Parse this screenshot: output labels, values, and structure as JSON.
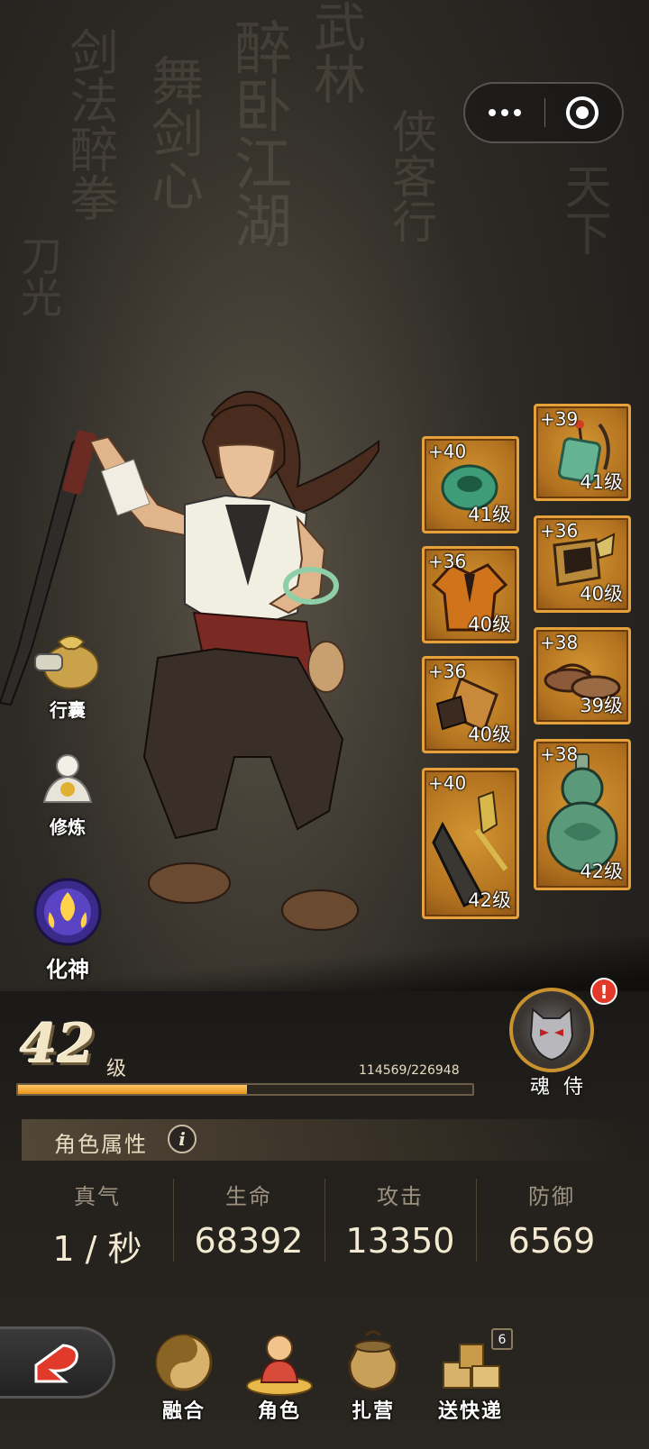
{
  "capsule": {
    "more_icon": "more-dots-icon",
    "close_icon": "target-circle-icon"
  },
  "side_menu": [
    {
      "label": "行囊",
      "icon": "bag-icon"
    },
    {
      "label": "修炼",
      "icon": "cultivate-icon"
    },
    {
      "label": "化神",
      "icon": "transform-spirit-icon"
    }
  ],
  "equipment": [
    {
      "plus": "+40",
      "level": "41级",
      "icon": "jade-ring-icon"
    },
    {
      "plus": "+39",
      "level": "41级",
      "icon": "jade-pendant-icon"
    },
    {
      "plus": "+36",
      "level": "40级",
      "icon": "robe-icon"
    },
    {
      "plus": "+36",
      "level": "40级",
      "icon": "belt-icon"
    },
    {
      "plus": "+36",
      "level": "40级",
      "icon": "bracer-icon"
    },
    {
      "plus": "+38",
      "level": "39级",
      "icon": "sandals-icon"
    },
    {
      "plus": "+40",
      "level": "42级",
      "icon": "broadsword-icon"
    },
    {
      "plus": "+38",
      "level": "42级",
      "icon": "gourd-icon"
    }
  ],
  "level": {
    "value": "42",
    "unit": "级",
    "xp_text": "114569/226948",
    "xp_fraction": 0.5048
  },
  "soul_guard": {
    "label": "魂 侍",
    "alert": "!"
  },
  "attributes": {
    "title": "角色属性",
    "info": "i",
    "stats": [
      {
        "name": "真气",
        "value": "1 / 秒"
      },
      {
        "name": "生命",
        "value": "68392"
      },
      {
        "name": "攻击",
        "value": "13350"
      },
      {
        "name": "防御",
        "value": "6569"
      }
    ]
  },
  "nav": {
    "items": [
      {
        "label": "融合",
        "icon": "fusion-icon"
      },
      {
        "label": "角色",
        "icon": "character-icon"
      },
      {
        "label": "扎营",
        "icon": "camp-icon"
      },
      {
        "label": "送快递",
        "icon": "delivery-icon"
      }
    ],
    "delivery_badge": "6"
  },
  "colors": {
    "slot_gold": "#e6a13a",
    "xp_orange": "#e8941c",
    "alert_red": "#e23a2a"
  }
}
